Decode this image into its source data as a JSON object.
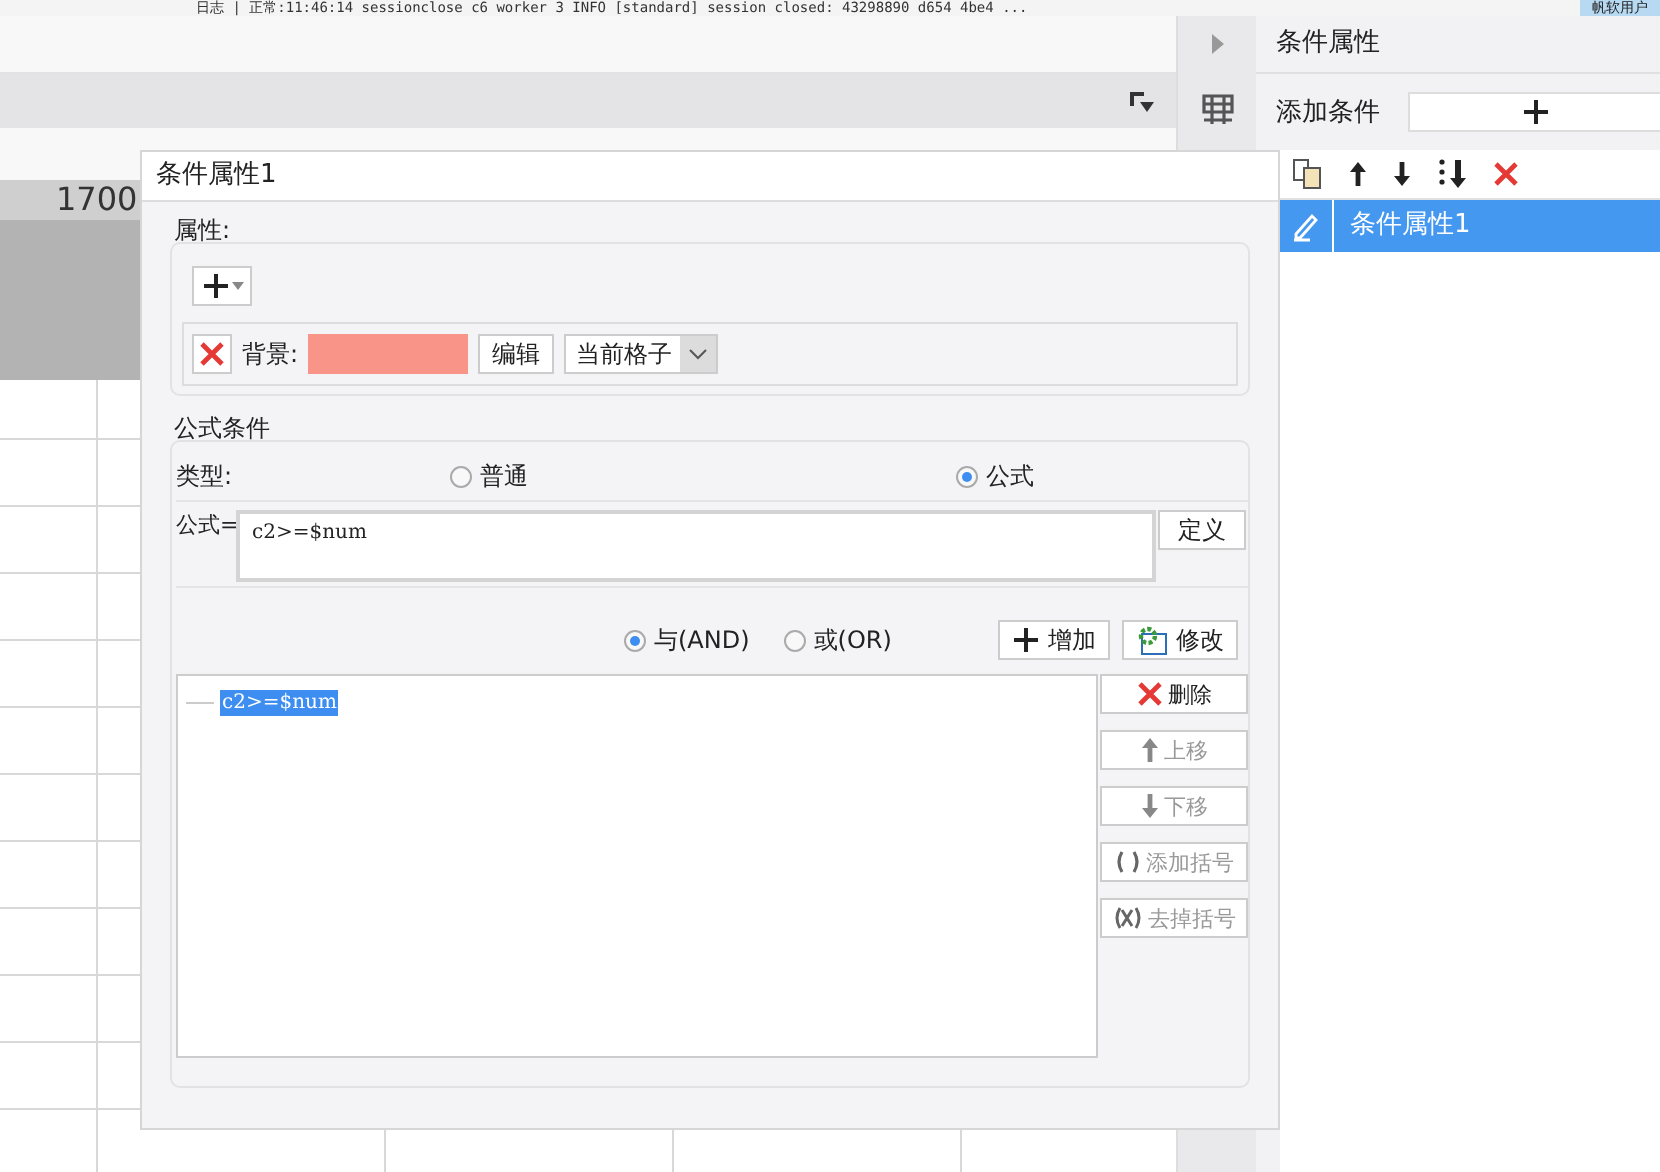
{
  "status_bar": {
    "text": "日志 | 正常:11:46:14 sessionclose c6 worker 3 INFO [standard] session closed: 43298890 d654 4be4 ...",
    "user": "帆软用户"
  },
  "sheet": {
    "ruler_label": "1700"
  },
  "right_panel": {
    "title": "条件属性",
    "add_label": "添加条件",
    "items": [
      {
        "label": "条件属性1",
        "selected": true
      }
    ]
  },
  "dialog": {
    "title": "条件属性1",
    "attributes": {
      "legend": "属性:",
      "rows": [
        {
          "label": "背景:",
          "color": "#f89488",
          "edit_button": "编辑",
          "scope": "当前格子"
        }
      ]
    },
    "formula_condition": {
      "legend": "公式条件",
      "type_label": "类型:",
      "types": [
        {
          "label": "普通",
          "selected": false
        },
        {
          "label": "公式",
          "selected": true
        }
      ],
      "formula_label": "公式=",
      "formula_value": "c2>=$num",
      "define_button": "定义",
      "logic": [
        {
          "label": "与(AND)",
          "selected": true
        },
        {
          "label": "或(OR)",
          "selected": false
        }
      ],
      "add_button": "增加",
      "modify_button": "修改",
      "conditions": [
        {
          "text": "c2>=$num",
          "selected": true
        }
      ],
      "side_buttons": [
        {
          "kind": "delete",
          "label": "删除",
          "disabled": false
        },
        {
          "kind": "up",
          "label": "上移",
          "disabled": true
        },
        {
          "kind": "down",
          "label": "下移",
          "disabled": true
        },
        {
          "kind": "add-paren",
          "label": "添加括号",
          "disabled": true
        },
        {
          "kind": "remove-paren",
          "label": "去掉括号",
          "disabled": true
        }
      ]
    }
  }
}
